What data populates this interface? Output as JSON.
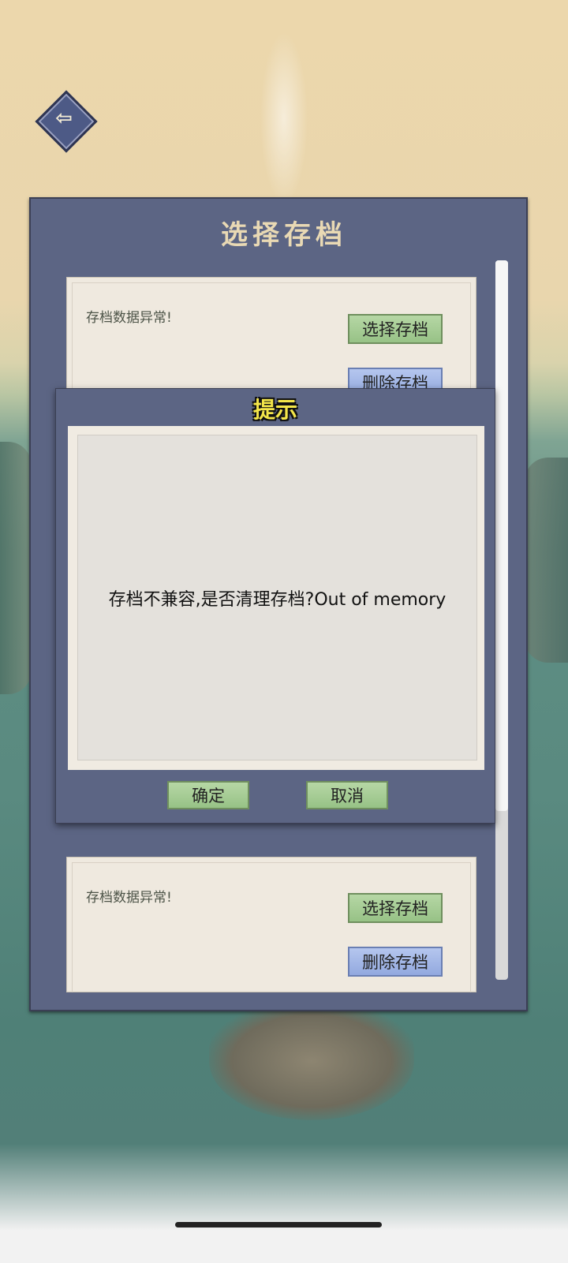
{
  "back": {
    "icon": "arrow-left-icon"
  },
  "panel": {
    "title": "选择存档",
    "slots": [
      {
        "status": "存档数据异常!",
        "select_label": "选择存档",
        "delete_label": "删除存档"
      },
      {
        "status": "存档数据异常!",
        "select_label": "选择存档",
        "delete_label": "删除存档"
      }
    ]
  },
  "dialog": {
    "title": "提示",
    "message": "存档不兼容,是否清理存档?Out of memory",
    "confirm_label": "确定",
    "cancel_label": "取消"
  }
}
